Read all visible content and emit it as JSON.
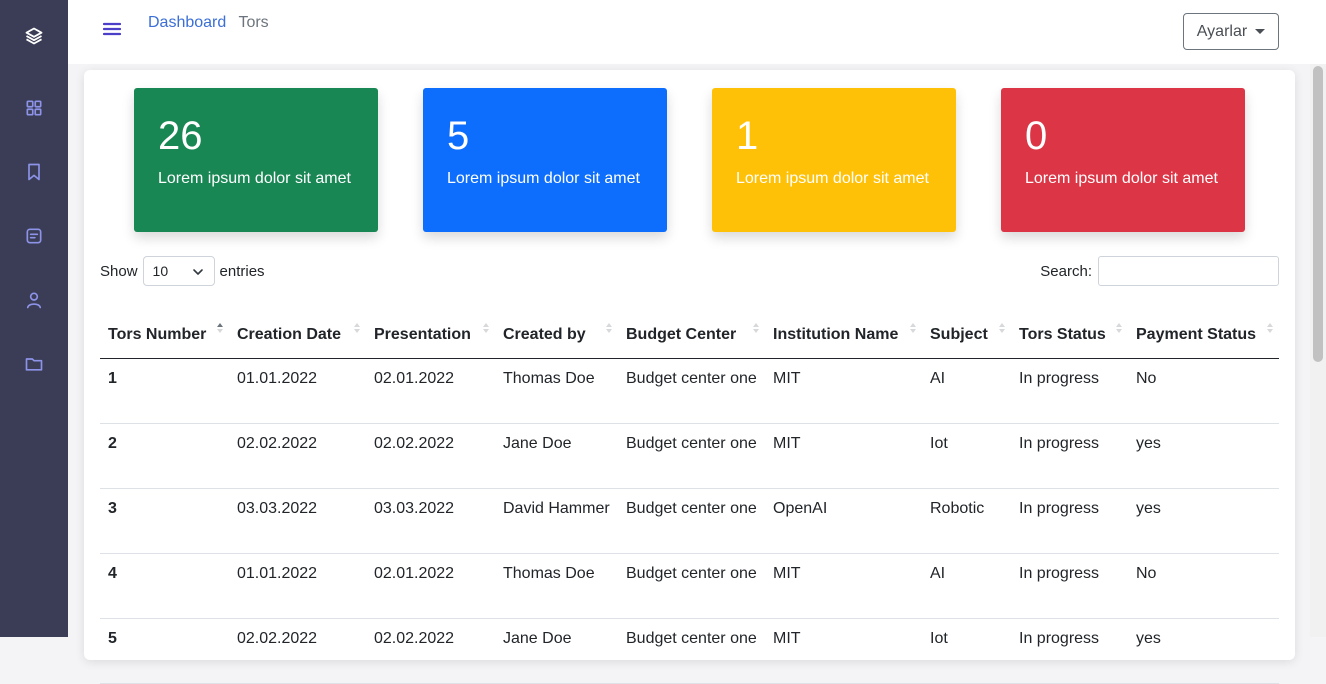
{
  "sidebar": {
    "icons": [
      "layers-icon",
      "grid-icon",
      "bookmark-icon",
      "message-icon",
      "user-icon",
      "folder-icon"
    ]
  },
  "breadcrumb": {
    "link": "Dashboard",
    "current": "Tors"
  },
  "settings_button": "Ayarlar",
  "stats": [
    {
      "value": "26",
      "label": "Lorem ipsum dolor sit amet",
      "color": "#198754"
    },
    {
      "value": "5",
      "label": "Lorem ipsum dolor sit amet",
      "color": "#0d6efd"
    },
    {
      "value": "1",
      "label": "Lorem ipsum dolor sit amet",
      "color": "#ffc107"
    },
    {
      "value": "0",
      "label": "Lorem ipsum dolor sit amet",
      "color": "#dc3545"
    }
  ],
  "controls": {
    "show_label": "Show",
    "length_value": "10",
    "entries_label": "entries",
    "search_label": "Search:",
    "search_value": ""
  },
  "table": {
    "headers": [
      "Tors Number",
      "Creation Date",
      "Presentation",
      "Created by",
      "Budget Center",
      "Institution Name",
      "Subject",
      "Tors Status",
      "Payment Status"
    ],
    "rows": [
      [
        "1",
        "01.01.2022",
        "02.01.2022",
        "Thomas Doe",
        "Budget center one",
        "MIT",
        "AI",
        "In progress",
        "No"
      ],
      [
        "2",
        "02.02.2022",
        "02.02.2022",
        "Jane Doe",
        "Budget center one",
        "MIT",
        "Iot",
        "In progress",
        "yes"
      ],
      [
        "3",
        "03.03.2022",
        "03.03.2022",
        "David Hammer",
        "Budget center one",
        "OpenAI",
        "Robotic",
        "In progress",
        "yes"
      ],
      [
        "4",
        "01.01.2022",
        "02.01.2022",
        "Thomas Doe",
        "Budget center one",
        "MIT",
        "AI",
        "In progress",
        "No"
      ],
      [
        "5",
        "02.02.2022",
        "02.02.2022",
        "Jane Doe",
        "Budget center one",
        "MIT",
        "Iot",
        "In progress",
        "yes"
      ]
    ]
  }
}
